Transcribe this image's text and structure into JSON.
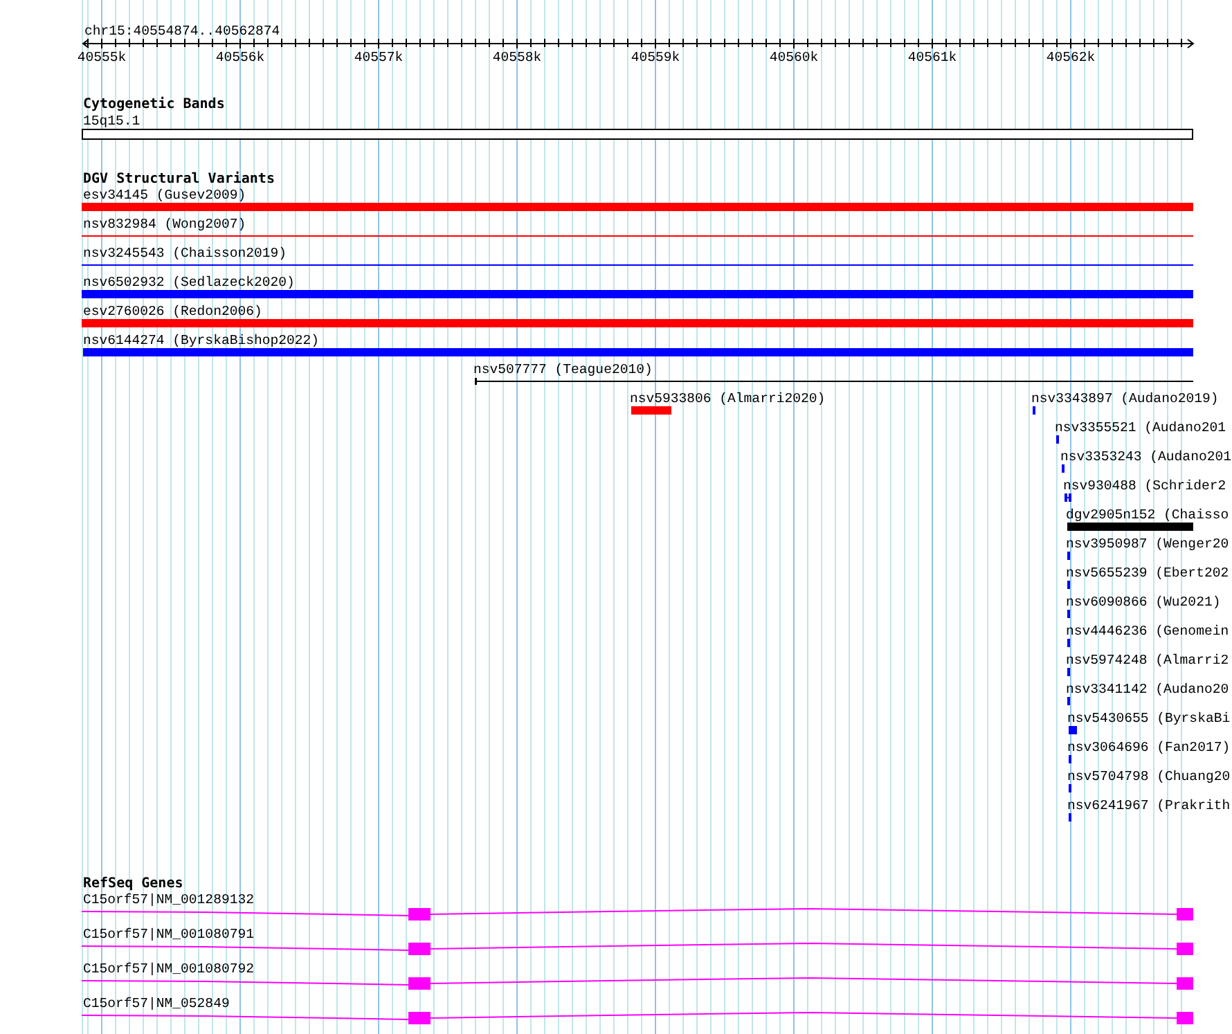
{
  "ruler": {
    "location": "chr15:40554874..40562874",
    "ticks": [
      "40555k",
      "40556k",
      "40557k",
      "40558k",
      "40559k",
      "40560k",
      "40561k",
      "40562k"
    ]
  },
  "tracks": [
    {
      "kind": "cytoband",
      "title": "Cytogenetic Bands",
      "bands": [
        {
          "name": "15q15.1"
        }
      ]
    },
    {
      "kind": "variants",
      "title": "DGV Structural Variants",
      "features": [
        {
          "label": "esv34145 (Gusev2009)",
          "kind": "bar",
          "color": "#ff0000"
        },
        {
          "label": "nsv832984 (Wong2007)",
          "kind": "line",
          "color": "#ff0000"
        },
        {
          "label": "nsv3245543 (Chaisson2019)",
          "kind": "line",
          "color": "#0000ff"
        },
        {
          "label": "nsv6502932 (Sedlazeck2020)",
          "kind": "bar",
          "color": "#0000ff"
        },
        {
          "label": "esv2760026 (Redon2006)",
          "kind": "bar",
          "color": "#ff0000"
        },
        {
          "label": "nsv6144274 (ByrskaBishop2022)",
          "kind": "bar",
          "color": "#0000ff"
        },
        {
          "label": "nsv507777 (Teague2010)",
          "kind": "line",
          "color": "#000000"
        },
        {
          "label": "nsv5933806 (Almarri2020)",
          "kind": "bar",
          "color": "#ff0000"
        },
        {
          "label": "nsv3343897 (Audano2019)",
          "kind": "bar",
          "color": "#0000ff"
        },
        {
          "label": "nsv3355521 (Audano201",
          "kind": "bar",
          "color": "#0000ff"
        },
        {
          "label": "nsv3353243 (Audano201",
          "kind": "bar",
          "color": "#0000ff"
        },
        {
          "label": "nsv930488 (Schrider2",
          "kind": "split",
          "color": "#0000ff"
        },
        {
          "label": "dgv2905n152 (Chaisso",
          "kind": "bar",
          "color": "#000000"
        },
        {
          "label": "nsv3950987 (Wenger20",
          "kind": "bar",
          "color": "#0000ff"
        },
        {
          "label": "nsv5655239 (Ebert202",
          "kind": "bar",
          "color": "#0000ff"
        },
        {
          "label": "nsv6090866 (Wu2021)",
          "kind": "bar",
          "color": "#0000ff"
        },
        {
          "label": "nsv4446236 (Genomein",
          "kind": "bar",
          "color": "#0000ff"
        },
        {
          "label": "nsv5974248 (Almarri2",
          "kind": "bar",
          "color": "#0000ff"
        },
        {
          "label": "nsv3341142 (Audano20",
          "kind": "bar",
          "color": "#0000ff"
        },
        {
          "label": "nsv5430655 (ByrskaBi",
          "kind": "bar",
          "color": "#0000ff"
        },
        {
          "label": "nsv3064696 (Fan2017)",
          "kind": "bar",
          "color": "#0000ff"
        },
        {
          "label": "nsv5704798 (Chuang20",
          "kind": "bar",
          "color": "#0000ff"
        },
        {
          "label": "nsv6241967 (Prakrith",
          "kind": "bar",
          "color": "#0000ff"
        }
      ]
    },
    {
      "kind": "genes",
      "title": "RefSeq Genes",
      "transcripts": [
        {
          "name": "C15orf57|NM_001289132"
        },
        {
          "name": "C15orf57|NM_001080791"
        },
        {
          "name": "C15orf57|NM_001080792"
        },
        {
          "name": "C15orf57|NM_052849"
        }
      ]
    }
  ]
}
